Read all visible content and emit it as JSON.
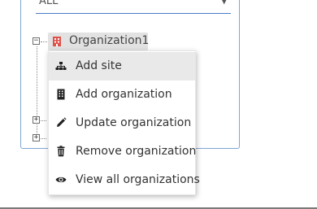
{
  "filter": {
    "selected": "ALL",
    "arrow_icon": "caret-down-icon"
  },
  "tree": {
    "root": {
      "label": "Organization1",
      "icon": "building-icon",
      "icon_color": "#e0504a",
      "expander": "−"
    },
    "collapsed_expanders": [
      "+",
      "+"
    ]
  },
  "context_menu": {
    "items": [
      {
        "label": "Add site",
        "icon": "sitemap-icon"
      },
      {
        "label": "Add organization",
        "icon": "building-icon"
      },
      {
        "label": "Update organization",
        "icon": "pencil-icon"
      },
      {
        "label": "Remove organization",
        "icon": "trash-icon"
      },
      {
        "label": "View all organizations",
        "icon": "eye-icon"
      }
    ]
  }
}
